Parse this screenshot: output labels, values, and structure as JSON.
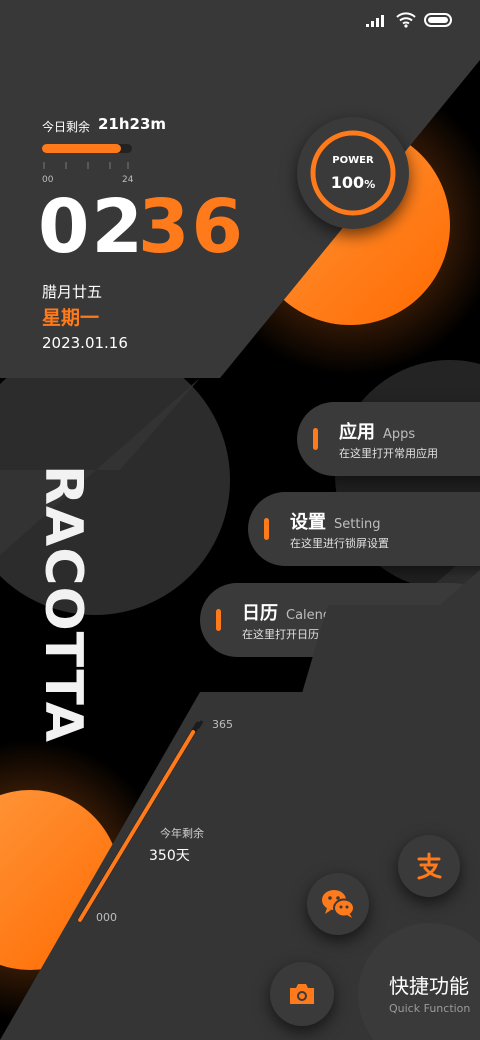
{
  "status_bar": {
    "signal_icon": "signal-bars-icon",
    "wifi_icon": "wifi-icon",
    "battery_icon": "battery-icon"
  },
  "remaining_today": {
    "label": "今日剩余",
    "value": "21h23m",
    "progress": 0.88,
    "scale_start": "00",
    "scale_end": "24"
  },
  "clock": {
    "hours": "02",
    "minutes": "36"
  },
  "date": {
    "lunar": "腊月廿五",
    "weekday": "星期一",
    "full": "2023.01.16"
  },
  "power": {
    "label": "POWER",
    "value": "100",
    "unit": "%",
    "level": 1.0
  },
  "brand_text": "RACOTTA",
  "shortcuts": [
    {
      "title": "应用",
      "title_en": "Apps",
      "subtitle": "在这里打开常用应用"
    },
    {
      "title": "设置",
      "title_en": "Setting",
      "subtitle": "在这里进行锁屏设置"
    },
    {
      "title": "日历",
      "title_en": "Calende",
      "subtitle": "在这里打开日历"
    }
  ],
  "year": {
    "max_label": "365",
    "min_label": "000",
    "label": "今年剩余",
    "value": "350天",
    "progress": 0.959
  },
  "quick": {
    "title": "快捷功能",
    "subtitle": "Quick Function",
    "icons": [
      "alipay-icon",
      "wechat-icon",
      "camera-icon"
    ]
  },
  "colors": {
    "accent": "#ff7a1a",
    "panel": "#3a3a3a",
    "background": "#000000"
  }
}
